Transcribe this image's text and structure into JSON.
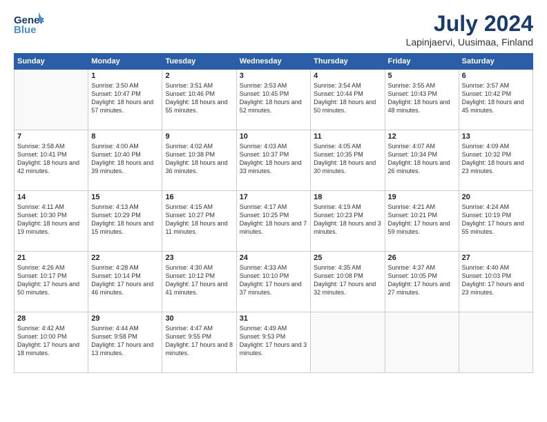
{
  "header": {
    "logo_general": "General",
    "logo_blue": "Blue",
    "title": "July 2024",
    "subtitle": "Lapinjaervi, Uusimaa, Finland"
  },
  "days_of_week": [
    "Sunday",
    "Monday",
    "Tuesday",
    "Wednesday",
    "Thursday",
    "Friday",
    "Saturday"
  ],
  "weeks": [
    [
      {
        "day": "",
        "sunrise": "",
        "sunset": "",
        "daylight": ""
      },
      {
        "day": "1",
        "sunrise": "Sunrise: 3:50 AM",
        "sunset": "Sunset: 10:47 PM",
        "daylight": "Daylight: 18 hours and 57 minutes."
      },
      {
        "day": "2",
        "sunrise": "Sunrise: 3:51 AM",
        "sunset": "Sunset: 10:46 PM",
        "daylight": "Daylight: 18 hours and 55 minutes."
      },
      {
        "day": "3",
        "sunrise": "Sunrise: 3:53 AM",
        "sunset": "Sunset: 10:45 PM",
        "daylight": "Daylight: 18 hours and 52 minutes."
      },
      {
        "day": "4",
        "sunrise": "Sunrise: 3:54 AM",
        "sunset": "Sunset: 10:44 PM",
        "daylight": "Daylight: 18 hours and 50 minutes."
      },
      {
        "day": "5",
        "sunrise": "Sunrise: 3:55 AM",
        "sunset": "Sunset: 10:43 PM",
        "daylight": "Daylight: 18 hours and 48 minutes."
      },
      {
        "day": "6",
        "sunrise": "Sunrise: 3:57 AM",
        "sunset": "Sunset: 10:42 PM",
        "daylight": "Daylight: 18 hours and 45 minutes."
      }
    ],
    [
      {
        "day": "7",
        "sunrise": "Sunrise: 3:58 AM",
        "sunset": "Sunset: 10:41 PM",
        "daylight": "Daylight: 18 hours and 42 minutes."
      },
      {
        "day": "8",
        "sunrise": "Sunrise: 4:00 AM",
        "sunset": "Sunset: 10:40 PM",
        "daylight": "Daylight: 18 hours and 39 minutes."
      },
      {
        "day": "9",
        "sunrise": "Sunrise: 4:02 AM",
        "sunset": "Sunset: 10:38 PM",
        "daylight": "Daylight: 18 hours and 36 minutes."
      },
      {
        "day": "10",
        "sunrise": "Sunrise: 4:03 AM",
        "sunset": "Sunset: 10:37 PM",
        "daylight": "Daylight: 18 hours and 33 minutes."
      },
      {
        "day": "11",
        "sunrise": "Sunrise: 4:05 AM",
        "sunset": "Sunset: 10:35 PM",
        "daylight": "Daylight: 18 hours and 30 minutes."
      },
      {
        "day": "12",
        "sunrise": "Sunrise: 4:07 AM",
        "sunset": "Sunset: 10:34 PM",
        "daylight": "Daylight: 18 hours and 26 minutes."
      },
      {
        "day": "13",
        "sunrise": "Sunrise: 4:09 AM",
        "sunset": "Sunset: 10:32 PM",
        "daylight": "Daylight: 18 hours and 23 minutes."
      }
    ],
    [
      {
        "day": "14",
        "sunrise": "Sunrise: 4:11 AM",
        "sunset": "Sunset: 10:30 PM",
        "daylight": "Daylight: 18 hours and 19 minutes."
      },
      {
        "day": "15",
        "sunrise": "Sunrise: 4:13 AM",
        "sunset": "Sunset: 10:29 PM",
        "daylight": "Daylight: 18 hours and 15 minutes."
      },
      {
        "day": "16",
        "sunrise": "Sunrise: 4:15 AM",
        "sunset": "Sunset: 10:27 PM",
        "daylight": "Daylight: 18 hours and 11 minutes."
      },
      {
        "day": "17",
        "sunrise": "Sunrise: 4:17 AM",
        "sunset": "Sunset: 10:25 PM",
        "daylight": "Daylight: 18 hours and 7 minutes."
      },
      {
        "day": "18",
        "sunrise": "Sunrise: 4:19 AM",
        "sunset": "Sunset: 10:23 PM",
        "daylight": "Daylight: 18 hours and 3 minutes."
      },
      {
        "day": "19",
        "sunrise": "Sunrise: 4:21 AM",
        "sunset": "Sunset: 10:21 PM",
        "daylight": "Daylight: 17 hours and 59 minutes."
      },
      {
        "day": "20",
        "sunrise": "Sunrise: 4:24 AM",
        "sunset": "Sunset: 10:19 PM",
        "daylight": "Daylight: 17 hours and 55 minutes."
      }
    ],
    [
      {
        "day": "21",
        "sunrise": "Sunrise: 4:26 AM",
        "sunset": "Sunset: 10:17 PM",
        "daylight": "Daylight: 17 hours and 50 minutes."
      },
      {
        "day": "22",
        "sunrise": "Sunrise: 4:28 AM",
        "sunset": "Sunset: 10:14 PM",
        "daylight": "Daylight: 17 hours and 46 minutes."
      },
      {
        "day": "23",
        "sunrise": "Sunrise: 4:30 AM",
        "sunset": "Sunset: 10:12 PM",
        "daylight": "Daylight: 17 hours and 41 minutes."
      },
      {
        "day": "24",
        "sunrise": "Sunrise: 4:33 AM",
        "sunset": "Sunset: 10:10 PM",
        "daylight": "Daylight: 17 hours and 37 minutes."
      },
      {
        "day": "25",
        "sunrise": "Sunrise: 4:35 AM",
        "sunset": "Sunset: 10:08 PM",
        "daylight": "Daylight: 17 hours and 32 minutes."
      },
      {
        "day": "26",
        "sunrise": "Sunrise: 4:37 AM",
        "sunset": "Sunset: 10:05 PM",
        "daylight": "Daylight: 17 hours and 27 minutes."
      },
      {
        "day": "27",
        "sunrise": "Sunrise: 4:40 AM",
        "sunset": "Sunset: 10:03 PM",
        "daylight": "Daylight: 17 hours and 23 minutes."
      }
    ],
    [
      {
        "day": "28",
        "sunrise": "Sunrise: 4:42 AM",
        "sunset": "Sunset: 10:00 PM",
        "daylight": "Daylight: 17 hours and 18 minutes."
      },
      {
        "day": "29",
        "sunrise": "Sunrise: 4:44 AM",
        "sunset": "Sunset: 9:58 PM",
        "daylight": "Daylight: 17 hours and 13 minutes."
      },
      {
        "day": "30",
        "sunrise": "Sunrise: 4:47 AM",
        "sunset": "Sunset: 9:55 PM",
        "daylight": "Daylight: 17 hours and 8 minutes."
      },
      {
        "day": "31",
        "sunrise": "Sunrise: 4:49 AM",
        "sunset": "Sunset: 9:53 PM",
        "daylight": "Daylight: 17 hours and 3 minutes."
      },
      {
        "day": "",
        "sunrise": "",
        "sunset": "",
        "daylight": ""
      },
      {
        "day": "",
        "sunrise": "",
        "sunset": "",
        "daylight": ""
      },
      {
        "day": "",
        "sunrise": "",
        "sunset": "",
        "daylight": ""
      }
    ]
  ]
}
